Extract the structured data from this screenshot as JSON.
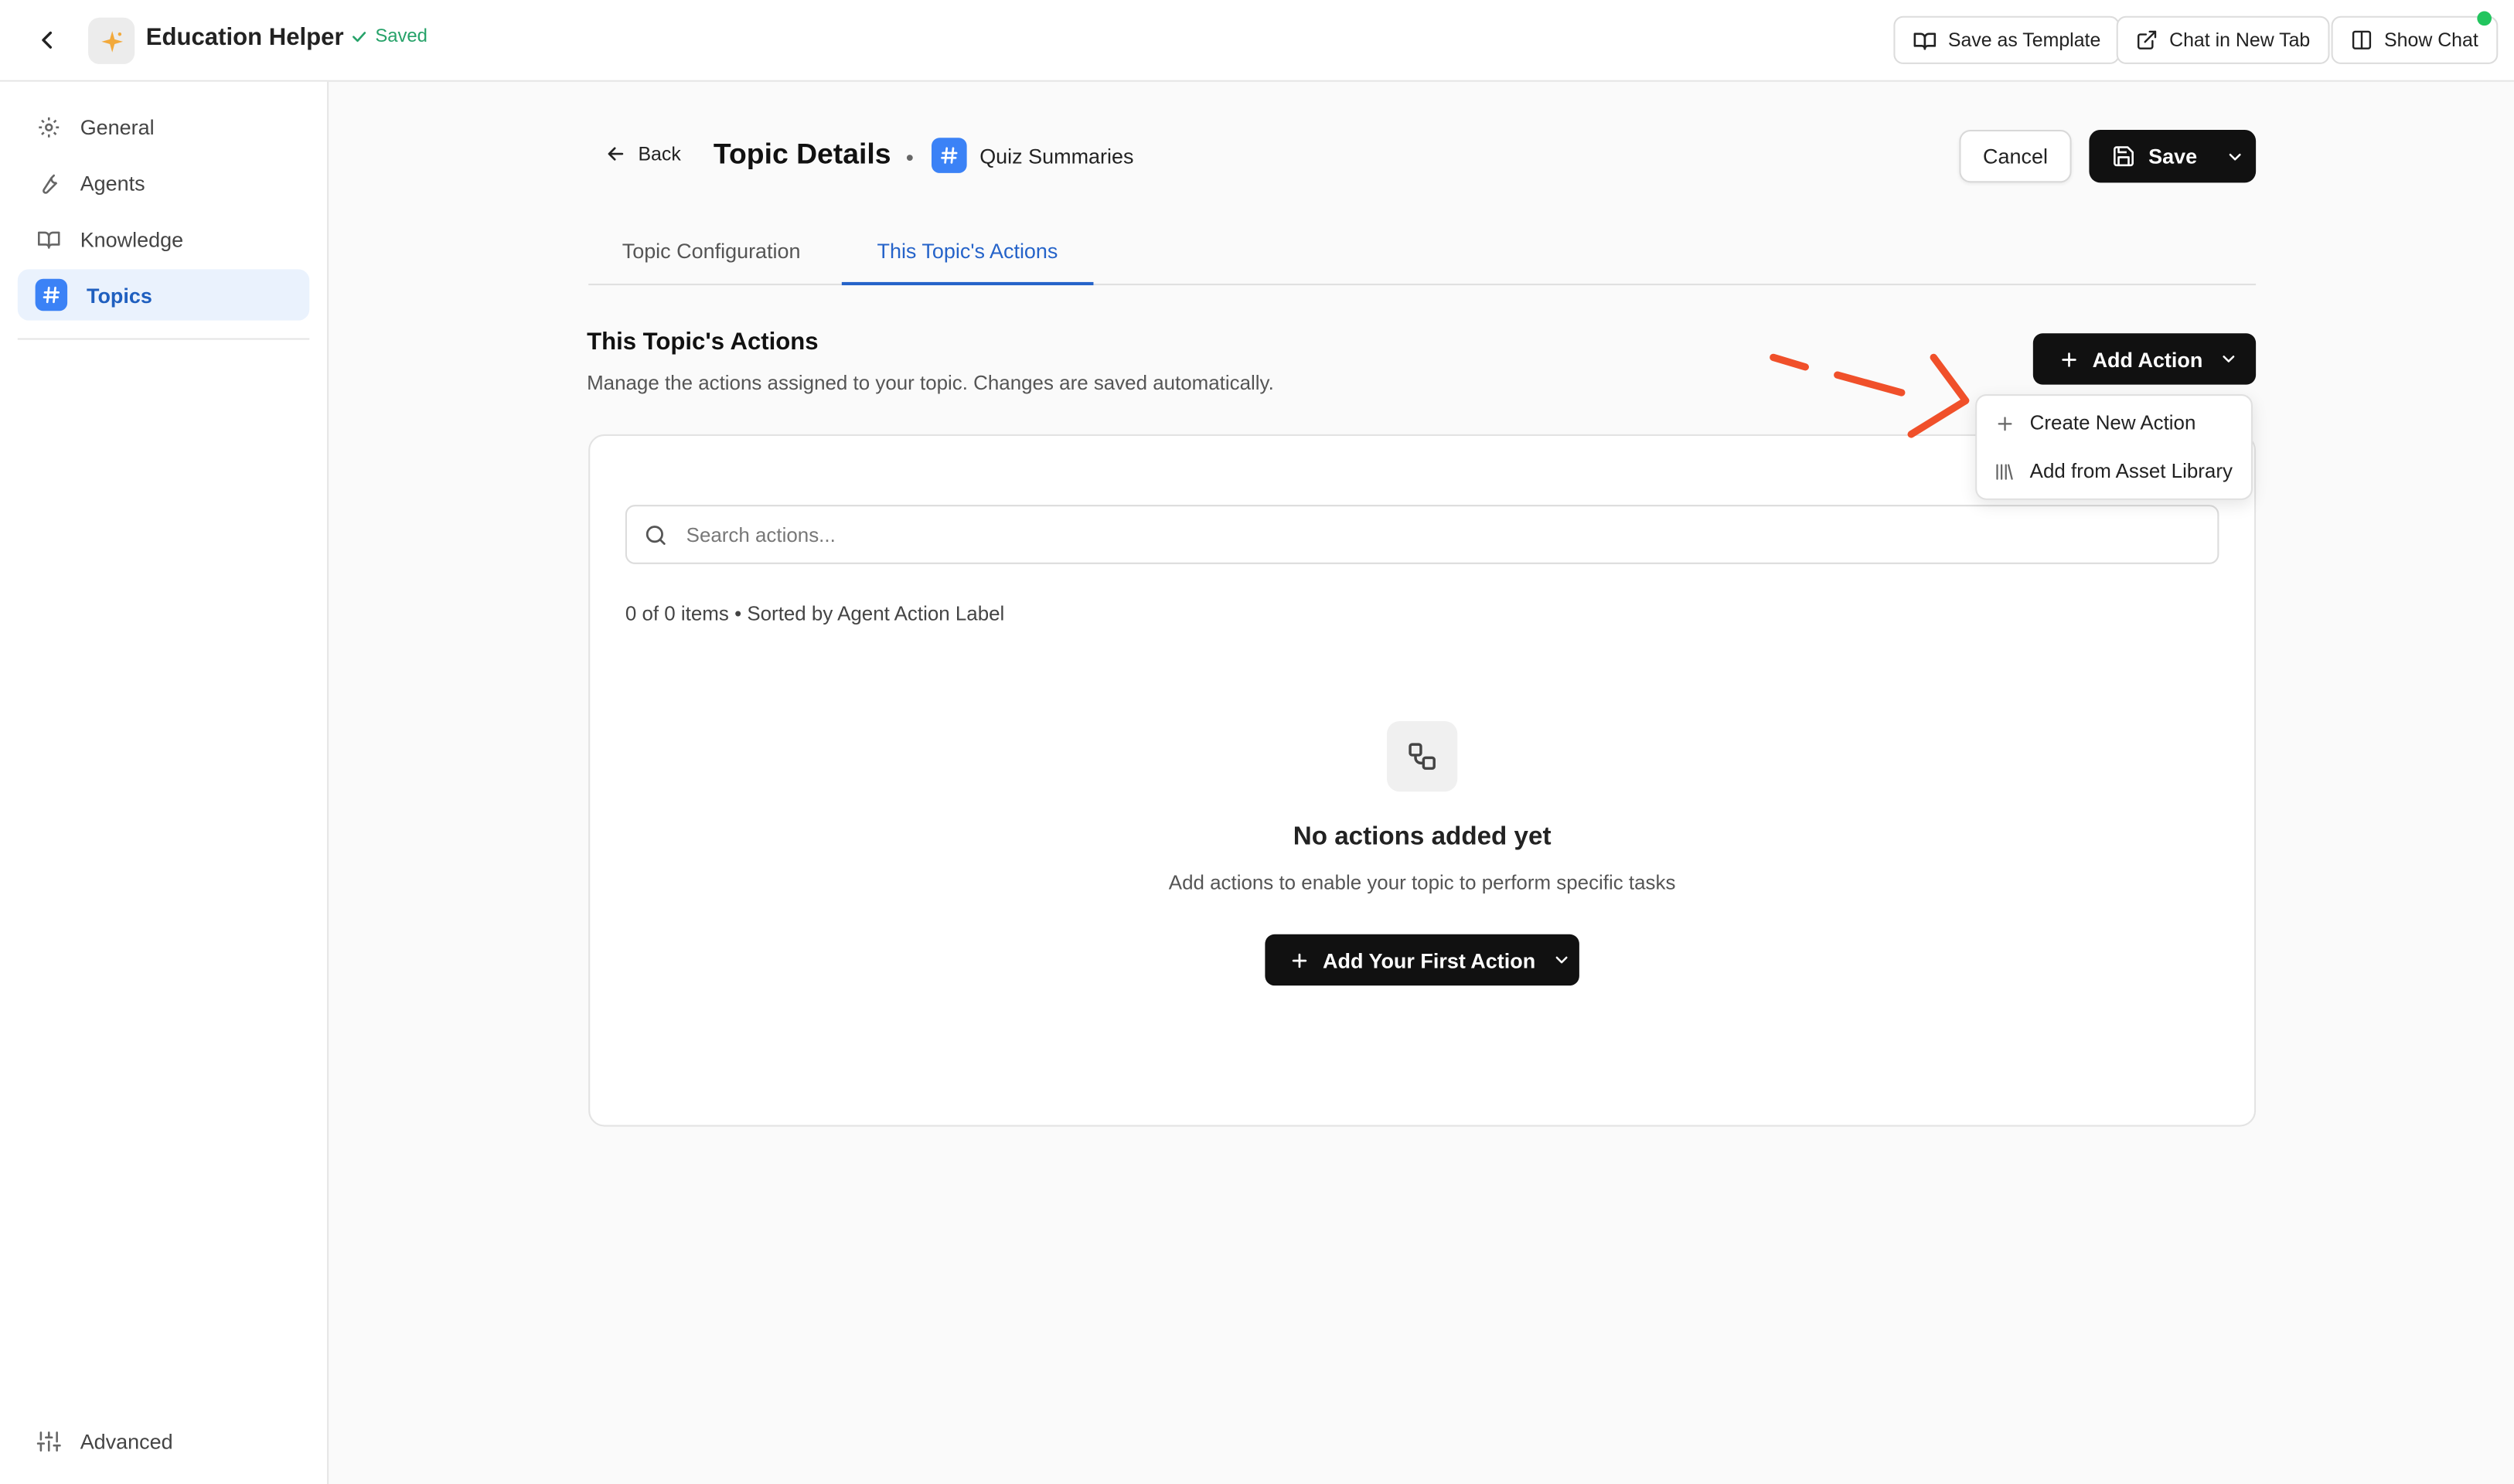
{
  "header": {
    "app_title": "Education Helper",
    "saved_label": "Saved",
    "save_template_label": "Save as Template",
    "chat_new_tab_label": "Chat in New Tab",
    "show_chat_label": "Show Chat"
  },
  "sidebar": {
    "items": [
      {
        "label": "General",
        "icon": "gear-icon"
      },
      {
        "label": "Agents",
        "icon": "wrench-icon"
      },
      {
        "label": "Knowledge",
        "icon": "book-icon"
      },
      {
        "label": "Topics",
        "icon": "hash-icon",
        "active": true
      }
    ],
    "advanced_label": "Advanced"
  },
  "page": {
    "back_label": "Back",
    "title": "Topic Details",
    "separator": "•",
    "crumb_label": "Quiz Summaries",
    "cancel_label": "Cancel",
    "save_label": "Save"
  },
  "tabs": [
    {
      "label": "Topic Configuration"
    },
    {
      "label": "This Topic's Actions",
      "active": true
    }
  ],
  "section": {
    "title": "This Topic's Actions",
    "description": "Manage the actions assigned to your topic. Changes are saved automatically.",
    "add_action_label": "Add Action"
  },
  "dropdown": {
    "items": [
      {
        "label": "Create New Action",
        "icon": "plus-icon"
      },
      {
        "label": "Add from Asset Library",
        "icon": "library-icon"
      }
    ]
  },
  "list": {
    "search_placeholder": "Search actions...",
    "count_text": "0 of 0 items • Sorted by Agent Action Label"
  },
  "empty_state": {
    "title": "No actions added yet",
    "description": "Add actions to enable your topic to perform specific tasks",
    "button_label": "Add Your First Action"
  },
  "colors": {
    "accent": "#2563c9",
    "badge_blue": "#3b82f6",
    "saved_green": "#26a269",
    "status_dot": "#22c55e",
    "annotation": "#f0502a",
    "primary_button": "#111111"
  }
}
